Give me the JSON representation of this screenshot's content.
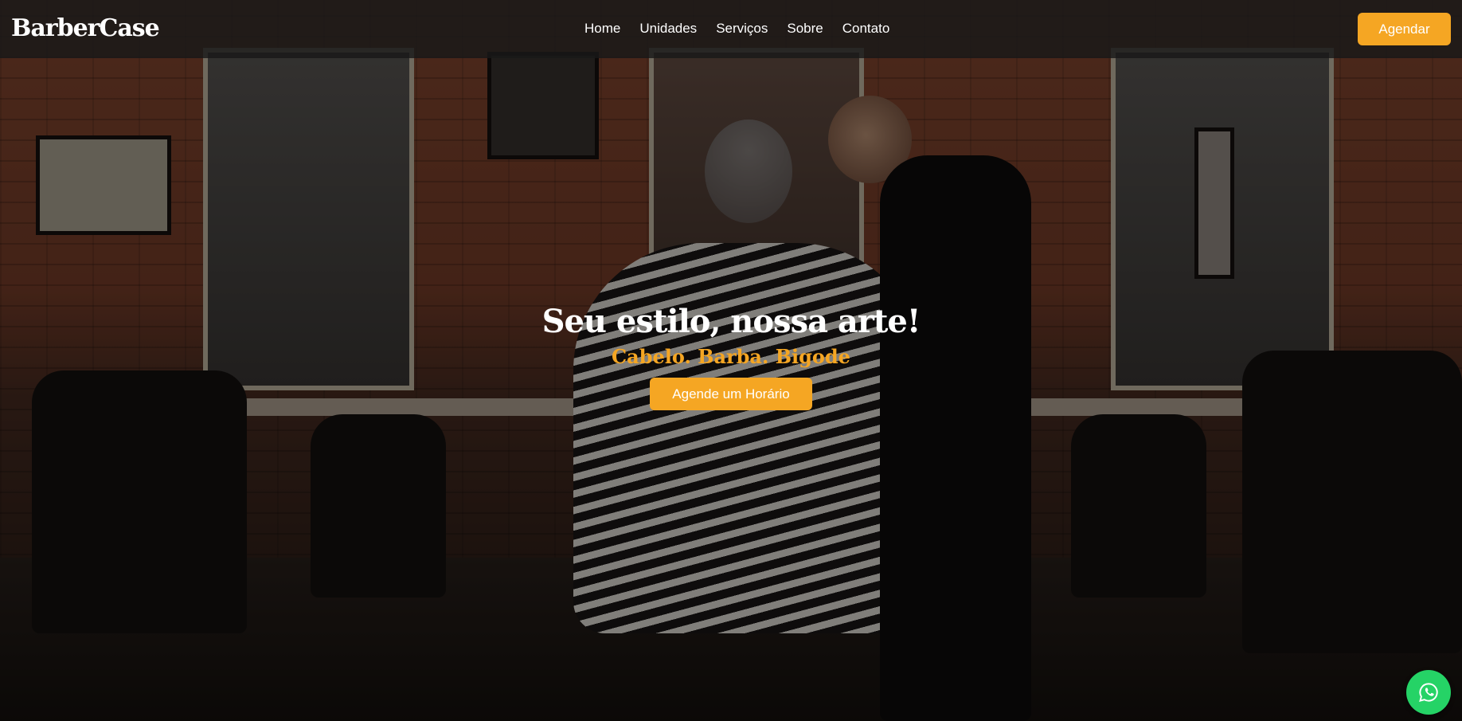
{
  "brand": {
    "logo_text": "BarberCase"
  },
  "nav": {
    "links": [
      {
        "label": "Home"
      },
      {
        "label": "Unidades"
      },
      {
        "label": "Serviços"
      },
      {
        "label": "Sobre"
      },
      {
        "label": "Contato"
      }
    ],
    "cta_label": "Agendar"
  },
  "hero": {
    "title": "Seu estilo, nossa arte!",
    "subtitle": "Cabelo. Barba. Bigode",
    "button_label": "Agende um Horário",
    "background_icon": "barbershop-photo"
  },
  "floating": {
    "whatsapp_icon": "whatsapp-icon"
  },
  "colors": {
    "accent": "#f5a623",
    "navbar_bg": "#191919",
    "text": "#ffffff",
    "whatsapp": "#25d366"
  }
}
